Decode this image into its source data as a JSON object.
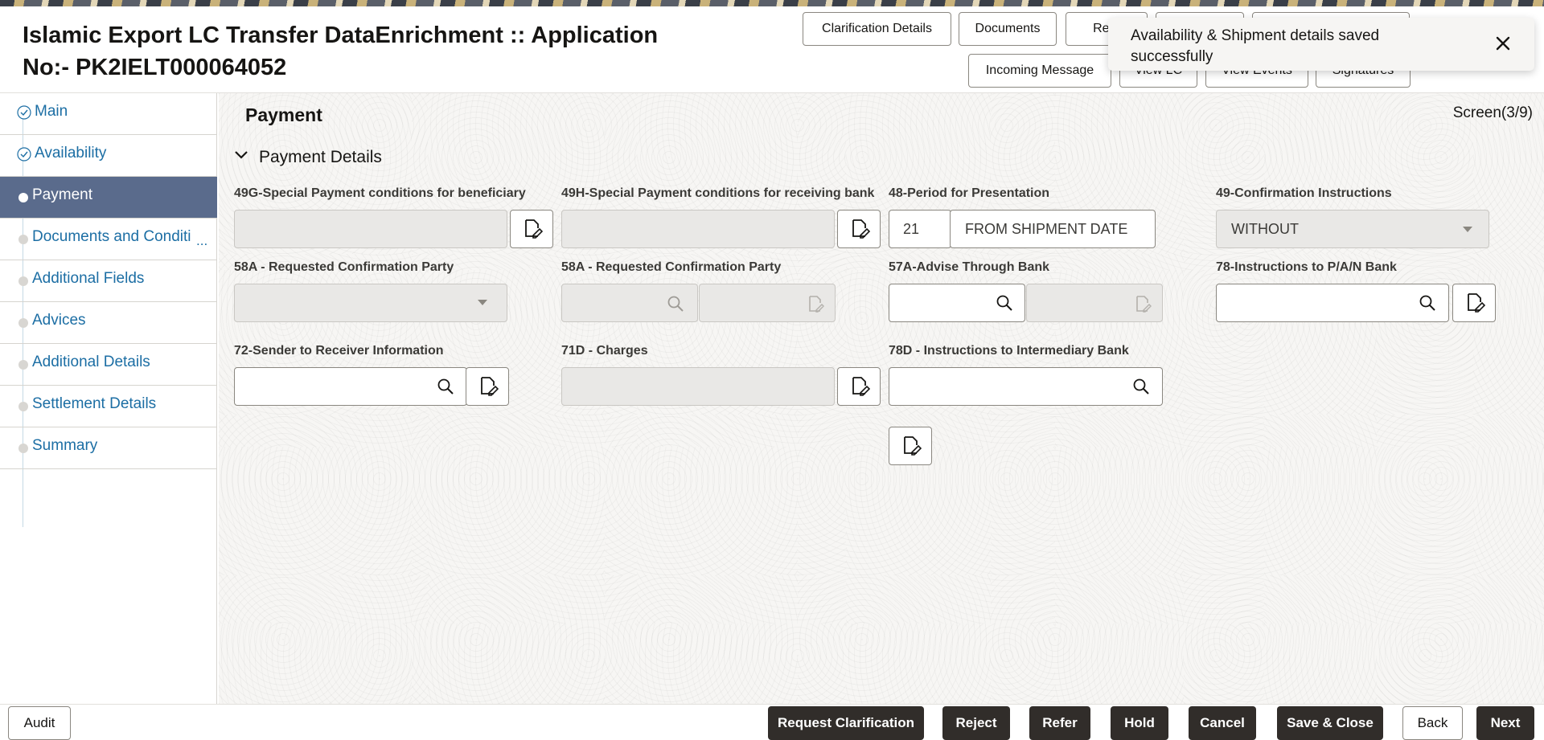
{
  "header": {
    "title": "Islamic Export LC Transfer DataEnrichment :: Application No:- PK2IELT000064052",
    "buttons_row1": [
      "Clarification Details",
      "Documents",
      "Rem"
    ],
    "buttons_row2": [
      "Incoming Message",
      "View LC",
      "View Events",
      "Signatures"
    ]
  },
  "toast": {
    "message": "Availability & Shipment details saved successfully",
    "close_icon": "close-icon"
  },
  "sidebar": {
    "items": [
      {
        "label": "Main",
        "state": "complete"
      },
      {
        "label": "Availability",
        "state": "complete"
      },
      {
        "label": "Payment",
        "state": "active"
      },
      {
        "label": "Documents and Conditi",
        "state": "pending",
        "more": "..."
      },
      {
        "label": "Additional Fields",
        "state": "pending"
      },
      {
        "label": "Advices",
        "state": "pending"
      },
      {
        "label": "Additional Details",
        "state": "pending"
      },
      {
        "label": "Settlement Details",
        "state": "pending"
      },
      {
        "label": "Summary",
        "state": "pending"
      }
    ]
  },
  "main": {
    "page_title": "Payment",
    "screen_count": "Screen(3/9)",
    "section_title": "Payment Details",
    "fields": {
      "f49g": {
        "label": "49G-Special Payment conditions for beneficiary",
        "value": ""
      },
      "f49h": {
        "label": "49H-Special Payment conditions for receiving bank",
        "value": ""
      },
      "f48": {
        "label": "48-Period for Presentation",
        "days": "21",
        "narrative": "FROM SHIPMENT DATE"
      },
      "f49": {
        "label": "49-Confirmation Instructions",
        "value": "WITHOUT"
      },
      "f58a1": {
        "label": "58A - Requested Confirmation Party",
        "value": ""
      },
      "f58a2": {
        "label": "58A - Requested Confirmation Party",
        "value": ""
      },
      "f57a": {
        "label": "57A-Advise Through Bank",
        "value": ""
      },
      "f78": {
        "label": "78-Instructions to P/A/N Bank",
        "value": ""
      },
      "f72": {
        "label": "72-Sender to Receiver Information",
        "value": ""
      },
      "f71d": {
        "label": "71D - Charges",
        "value": ""
      },
      "f78d": {
        "label": "78D - Instructions to Intermediary Bank",
        "value": ""
      }
    }
  },
  "footer": {
    "audit": "Audit",
    "request_clarification": "Request Clarification",
    "reject": "Reject",
    "refer": "Refer",
    "hold": "Hold",
    "cancel": "Cancel",
    "save_close": "Save & Close",
    "back": "Back",
    "next": "Next"
  },
  "colors": {
    "accent_link": "#1c6ea4",
    "active_nav": "#5a6b8c",
    "primary_button": "#312d2a"
  }
}
